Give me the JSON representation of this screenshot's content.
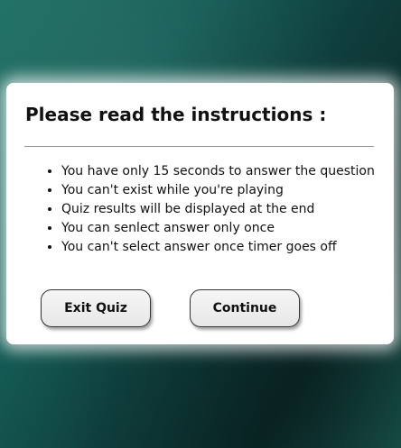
{
  "modal": {
    "title": "Please read the instructions :",
    "rules": [
      "You have only 15 seconds to answer the question",
      "You can't exist while you're playing",
      "Quiz results will be displayed at the end",
      "You can senlect answer only once",
      "You can't select answer once timer goes off"
    ],
    "buttons": {
      "exit_label": "Exit Quiz",
      "continue_label": "Continue"
    }
  },
  "colors": {
    "background_start": "#1e6f63",
    "background_end": "#0b2a2a",
    "modal_bg": "#ffffff",
    "text": "#111111"
  }
}
